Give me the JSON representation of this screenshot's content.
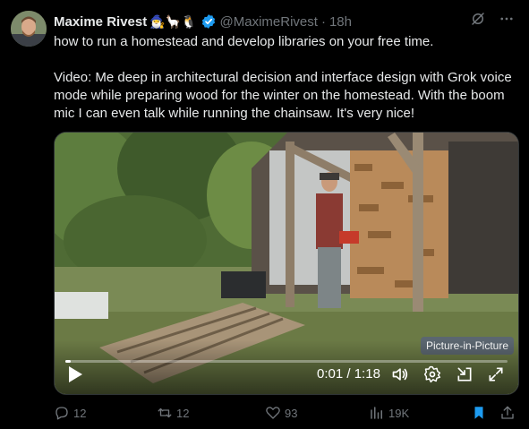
{
  "author": {
    "name": "Maxime Rivest",
    "emojis": "🧙‍♂️🦙🐧",
    "handle": "@MaximeRivest",
    "separator": "·",
    "time": "18h"
  },
  "tweet": {
    "line1": "how to run a homestead and develop libraries on your free time.",
    "line2": "Video: Me deep in architectural decision and interface design with Grok voice mode while preparing wood for the winter on the homestead. With the boom mic I can even talk while running the chainsaw. It's very nice!"
  },
  "video": {
    "current_time": "0:01",
    "separator": "/",
    "duration": "1:18",
    "progress": 0.013,
    "tooltip": "Picture-in-Picture"
  },
  "actions": {
    "replies": "12",
    "reposts": "12",
    "likes": "93",
    "views": "19K"
  },
  "colors": {
    "background": "#000000",
    "text": "#e7e9ea",
    "muted": "#71767b",
    "verified": "#1d9bf0",
    "bookmark": "#1d9bf0"
  }
}
